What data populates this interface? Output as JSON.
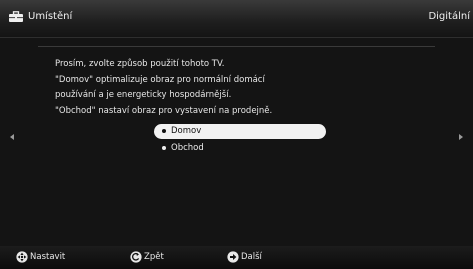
{
  "header": {
    "title": "Umístění",
    "mode": "Digitální",
    "icon": "toolbox-icon"
  },
  "intro_lines": [
    "Prosím, zvolte způsob použití tohoto TV.",
    "\"Domov\" optimalizuje obraz pro normální domácí",
    "používání a je energeticky hospodárnější.",
    "\"Obchod\" nastaví obraz pro vystavení na prodejně."
  ],
  "options": [
    {
      "label": "Domov",
      "selected": true
    },
    {
      "label": "Obchod",
      "selected": false
    }
  ],
  "footer": {
    "set_label": "Nastavit",
    "back_label": "Zpět",
    "next_label": "Další"
  },
  "colors": {
    "background": "#141414",
    "selected_bg": "#f2f2f2",
    "text": "#e8e8e8"
  }
}
